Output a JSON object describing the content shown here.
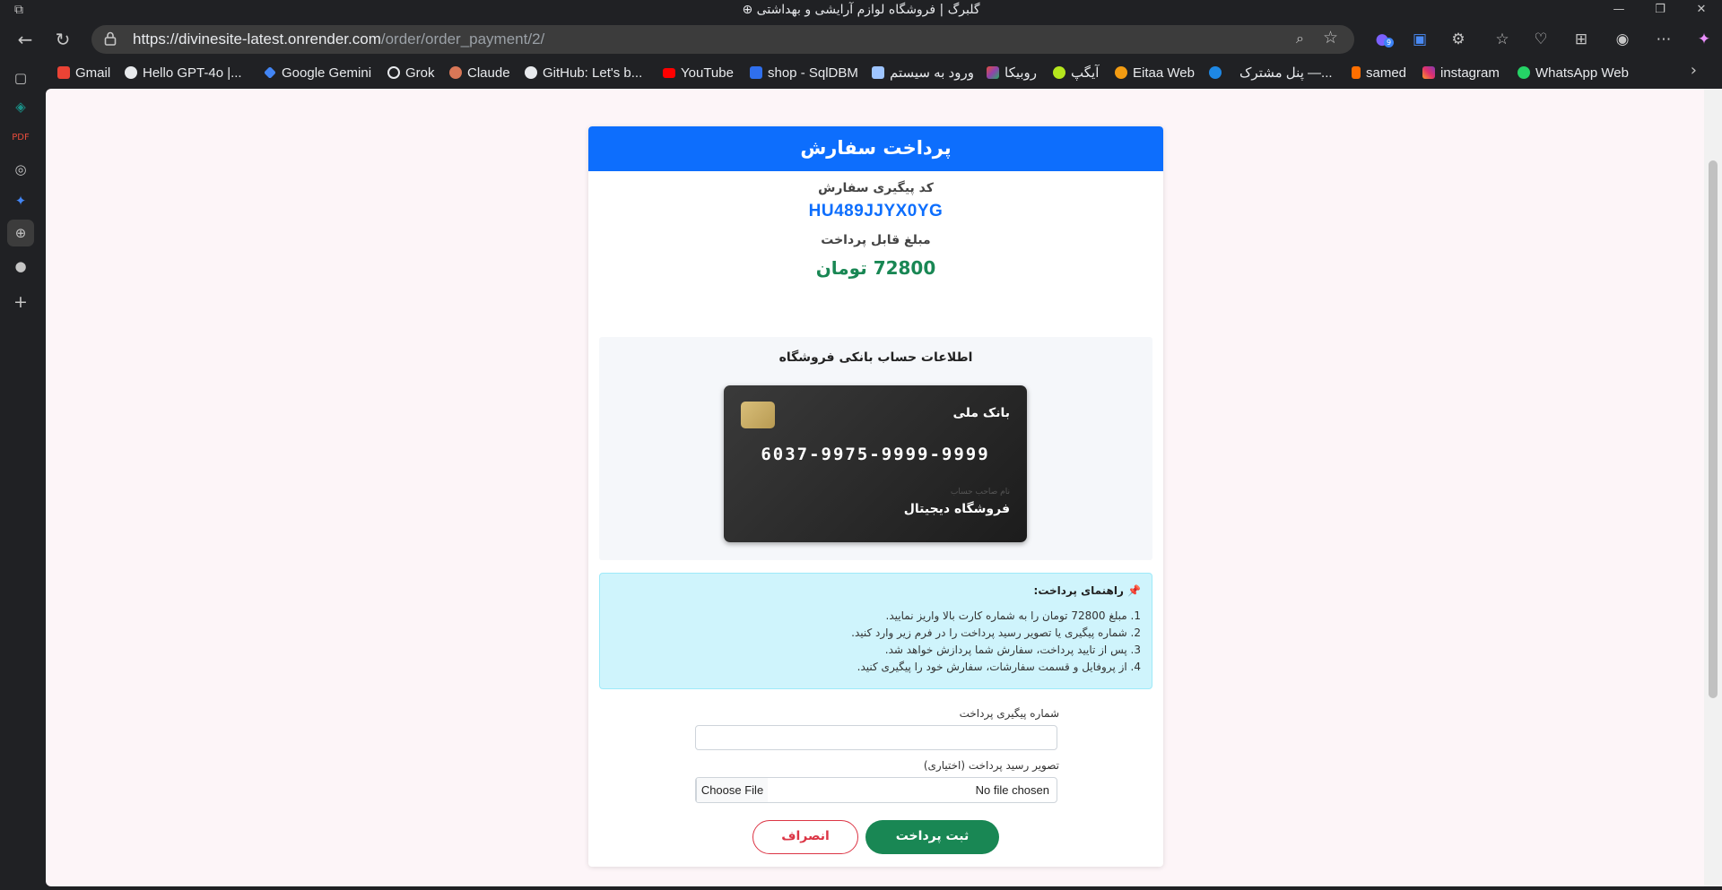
{
  "browser": {
    "window_title": "گلبرگ | فروشگاه لوازم آرایشی و بهداشتی",
    "url_host": "https://divinesite-latest.onrender.com",
    "url_path": "/order/order_payment/2/",
    "extension_badge": "9"
  },
  "bookmarks": [
    {
      "label": "Gmail",
      "icon": "gmail-icon",
      "color": "#ea4335"
    },
    {
      "label": "Hello GPT-4o |...",
      "icon": "openai-icon",
      "color": "#e8eaed"
    },
    {
      "label": "Google Gemini",
      "icon": "gemini-icon",
      "color": "#4285f4"
    },
    {
      "label": "Grok",
      "icon": "grok-icon",
      "color": "#e8eaed"
    },
    {
      "label": "Claude",
      "icon": "claude-icon",
      "color": "#d97757"
    },
    {
      "label": "GitHub: Let's b...",
      "icon": "github-icon",
      "color": "#e8eaed"
    },
    {
      "label": "YouTube",
      "icon": "youtube-icon",
      "color": "#ff0000"
    },
    {
      "label": "shop - SqlDBM",
      "icon": "sqldbm-icon",
      "color": "#2f6fed"
    },
    {
      "label": "ورود به سیستم",
      "icon": "login-icon",
      "color": "#9ec5ff"
    },
    {
      "label": "روبیکا",
      "icon": "rubika-icon",
      "color": "#8e44ad"
    },
    {
      "label": "آیگپ",
      "icon": "igap-icon",
      "color": "#b5e61d"
    },
    {
      "label": "Eitaa Web",
      "icon": "eitaa-icon",
      "color": "#f39c12"
    },
    {
      "label": "پنل مشترک —...",
      "icon": "edge-icon",
      "color": "#1e88e5"
    },
    {
      "label": "samed",
      "icon": "samed-icon",
      "color": "#ff6f00"
    },
    {
      "label": "instagram",
      "icon": "instagram-icon",
      "color": "#e1306c"
    },
    {
      "label": "WhatsApp Web",
      "icon": "whatsapp-icon",
      "color": "#25d366"
    }
  ],
  "page": {
    "header": "پرداخت سفارش",
    "tracking_label": "کد پیگیری سفارش",
    "tracking_code": "HU489JJYX0YG",
    "amount_label": "مبلغ قابل پرداخت",
    "amount": "72800 تومان",
    "bank_section_title": "اطلاعات حساب بانکی فروشگاه",
    "bank_card": {
      "bank_name": "بانک ملی",
      "card_number": "6037-9975-9999-9999",
      "holder_label": "نام صاحب حساب",
      "holder_name": "فروشگاه دیجیتال"
    },
    "guide": {
      "title": "📌 راهنمای پرداخت:",
      "steps": [
        "1. مبلغ 72800 تومان را به شماره کارت بالا واریز نمایید.",
        "2. شماره پیگیری یا تصویر رسید پرداخت را در فرم زیر وارد کنید.",
        "3. پس از تایید پرداخت، سفارش شما پردازش خواهد شد.",
        "4. از پروفایل و قسمت سفارشات، سفارش خود را پیگیری کنید."
      ]
    },
    "form": {
      "tracking_field_label": "شماره پیگیری پرداخت",
      "tracking_field_value": "",
      "receipt_field_label": "تصویر رسید پرداخت (اختیاری)",
      "file_button_label": "Choose File",
      "file_status": "No file chosen",
      "submit_label": "ثبت پرداخت",
      "cancel_label": "انصراف"
    }
  },
  "colors": {
    "primary": "#0d6efd",
    "success": "#198754",
    "danger": "#dc3545",
    "info_bg": "#cff4fc"
  }
}
